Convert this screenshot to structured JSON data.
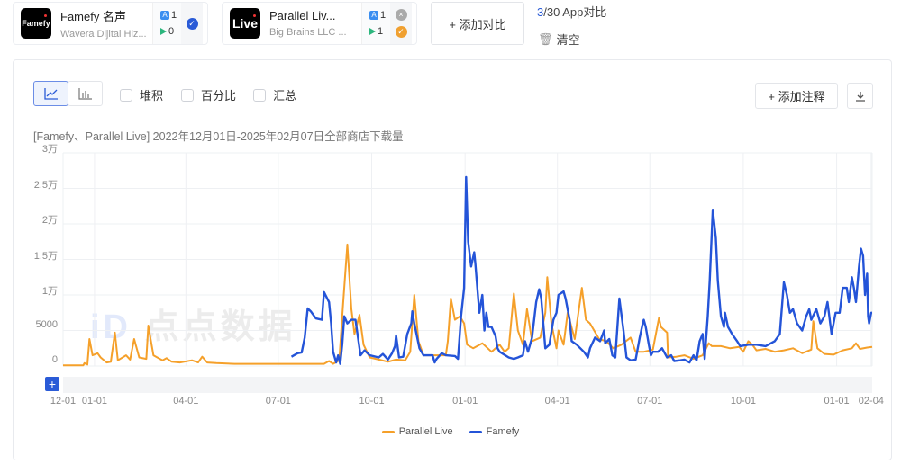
{
  "apps": [
    {
      "name": "Famefy  名声",
      "developer": "Wavera Dijital Hiz...",
      "logo_text": "Famefy",
      "ios_count": "1",
      "gp_count": "0",
      "check_color": "#2a5bd7"
    },
    {
      "name": "Parallel Liv...",
      "developer": "Big Brains LLC  ...",
      "logo_text": "Live",
      "ios_count": "1",
      "gp_count": "1",
      "check_color": "#f0a030"
    }
  ],
  "add_compare": "+ 添加对比",
  "compare_count": "3",
  "compare_total": "/30 App对比",
  "clear": "清空",
  "toolbar": {
    "stack": "堆积",
    "percent": "百分比",
    "sum": "汇总",
    "add_note": "+ 添加注释"
  },
  "watermark": "点点数据",
  "chart_data": {
    "type": "line",
    "title": "[Famefy、Parallel Live] 2022年12月01日-2025年02月07日全部商店下载量",
    "x_unit": "days since 2022-12-01",
    "xlim": [
      0,
      797
    ],
    "ylim": [
      0,
      30000
    ],
    "grid": true,
    "legend_position": "bottom",
    "y_ticks": [
      {
        "v": 0,
        "label": "0"
      },
      {
        "v": 5000,
        "label": "5000"
      },
      {
        "v": 10000,
        "label": "1万"
      },
      {
        "v": 15000,
        "label": "1.5万"
      },
      {
        "v": 20000,
        "label": "2万"
      },
      {
        "v": 25000,
        "label": "2.5万"
      },
      {
        "v": 30000,
        "label": "3万"
      }
    ],
    "x_ticks": [
      {
        "v": 0,
        "label": "12-01"
      },
      {
        "v": 31,
        "label": "01-01"
      },
      {
        "v": 121,
        "label": "04-01"
      },
      {
        "v": 212,
        "label": "07-01"
      },
      {
        "v": 304,
        "label": "10-01"
      },
      {
        "v": 396,
        "label": "01-01"
      },
      {
        "v": 487,
        "label": "04-01"
      },
      {
        "v": 578,
        "label": "07-01"
      },
      {
        "v": 670,
        "label": "10-01"
      },
      {
        "v": 762,
        "label": "01-01"
      },
      {
        "v": 796,
        "label": "02-04"
      }
    ],
    "series": [
      {
        "name": "Parallel Live",
        "color": "#f5a02a",
        "points": [
          [
            0,
            100
          ],
          [
            20,
            100
          ],
          [
            21,
            400
          ],
          [
            24,
            200
          ],
          [
            26,
            3800
          ],
          [
            29,
            1500
          ],
          [
            34,
            1800
          ],
          [
            37,
            1200
          ],
          [
            43,
            500
          ],
          [
            47,
            600
          ],
          [
            51,
            4700
          ],
          [
            54,
            800
          ],
          [
            62,
            1500
          ],
          [
            66,
            900
          ],
          [
            70,
            3800
          ],
          [
            75,
            1200
          ],
          [
            82,
            1000
          ],
          [
            84,
            5700
          ],
          [
            89,
            1500
          ],
          [
            98,
            800
          ],
          [
            102,
            1100
          ],
          [
            107,
            600
          ],
          [
            115,
            500
          ],
          [
            127,
            800
          ],
          [
            133,
            500
          ],
          [
            137,
            1300
          ],
          [
            142,
            500
          ],
          [
            151,
            400
          ],
          [
            169,
            300
          ],
          [
            257,
            300
          ],
          [
            262,
            700
          ],
          [
            266,
            300
          ],
          [
            272,
            800
          ],
          [
            276,
            9100
          ],
          [
            280,
            17100
          ],
          [
            284,
            8000
          ],
          [
            287,
            4500
          ],
          [
            292,
            7200
          ],
          [
            296,
            3000
          ],
          [
            302,
            1200
          ],
          [
            311,
            900
          ],
          [
            320,
            600
          ],
          [
            328,
            900
          ],
          [
            337,
            800
          ],
          [
            342,
            2000
          ],
          [
            346,
            10000
          ],
          [
            350,
            3500
          ],
          [
            355,
            1500
          ],
          [
            364,
            1500
          ],
          [
            377,
            1500
          ],
          [
            379,
            3500
          ],
          [
            382,
            9500
          ],
          [
            386,
            6500
          ],
          [
            391,
            7000
          ],
          [
            395,
            6000
          ],
          [
            398,
            3000
          ],
          [
            404,
            2500
          ],
          [
            413,
            3200
          ],
          [
            422,
            2000
          ],
          [
            430,
            3000
          ],
          [
            435,
            2000
          ],
          [
            439,
            2500
          ],
          [
            444,
            10200
          ],
          [
            448,
            5000
          ],
          [
            453,
            3000
          ],
          [
            457,
            8000
          ],
          [
            462,
            3500
          ],
          [
            470,
            4000
          ],
          [
            475,
            7500
          ],
          [
            477,
            12500
          ],
          [
            481,
            6000
          ],
          [
            486,
            2500
          ],
          [
            488,
            5000
          ],
          [
            493,
            3000
          ],
          [
            497,
            7500
          ],
          [
            504,
            3800
          ],
          [
            511,
            11000
          ],
          [
            515,
            6500
          ],
          [
            519,
            6000
          ],
          [
            528,
            3800
          ],
          [
            535,
            3500
          ],
          [
            542,
            2500
          ],
          [
            550,
            3000
          ],
          [
            559,
            4000
          ],
          [
            564,
            2000
          ],
          [
            572,
            2000
          ],
          [
            581,
            2300
          ],
          [
            587,
            6800
          ],
          [
            589,
            5500
          ],
          [
            595,
            4700
          ],
          [
            596,
            1200
          ],
          [
            604,
            1300
          ],
          [
            612,
            1500
          ],
          [
            621,
            1000
          ],
          [
            630,
            1500
          ],
          [
            636,
            3200
          ],
          [
            639,
            2800
          ],
          [
            648,
            2800
          ],
          [
            657,
            2500
          ],
          [
            666,
            2700
          ],
          [
            670,
            2000
          ],
          [
            675,
            3500
          ],
          [
            679,
            3000
          ],
          [
            683,
            2200
          ],
          [
            692,
            2400
          ],
          [
            701,
            2000
          ],
          [
            710,
            2200
          ],
          [
            719,
            2500
          ],
          [
            728,
            1800
          ],
          [
            737,
            2300
          ],
          [
            739,
            6300
          ],
          [
            743,
            2500
          ],
          [
            750,
            1700
          ],
          [
            759,
            1600
          ],
          [
            768,
            2200
          ],
          [
            777,
            2500
          ],
          [
            781,
            3200
          ],
          [
            785,
            2400
          ],
          [
            792,
            2600
          ],
          [
            797,
            2700
          ]
        ]
      },
      {
        "name": "Famefy",
        "color": "#2454d8",
        "points": [
          [
            225,
            1300
          ],
          [
            231,
            1800
          ],
          [
            235,
            1900
          ],
          [
            238,
            4000
          ],
          [
            241,
            8100
          ],
          [
            244,
            7700
          ],
          [
            249,
            6700
          ],
          [
            255,
            6500
          ],
          [
            257,
            10400
          ],
          [
            262,
            9000
          ],
          [
            264,
            6000
          ],
          [
            266,
            2000
          ],
          [
            269,
            500
          ],
          [
            271,
            1500
          ],
          [
            273,
            300
          ],
          [
            275,
            3000
          ],
          [
            277,
            7000
          ],
          [
            280,
            6000
          ],
          [
            284,
            6500
          ],
          [
            288,
            6500
          ],
          [
            291,
            3500
          ],
          [
            293,
            1500
          ],
          [
            297,
            2200
          ],
          [
            302,
            1500
          ],
          [
            311,
            1200
          ],
          [
            315,
            1700
          ],
          [
            320,
            900
          ],
          [
            324,
            1800
          ],
          [
            327,
            2800
          ],
          [
            328,
            4300
          ],
          [
            331,
            1200
          ],
          [
            335,
            1300
          ],
          [
            339,
            4500
          ],
          [
            343,
            6000
          ],
          [
            344,
            7700
          ],
          [
            346,
            6000
          ],
          [
            351,
            2500
          ],
          [
            355,
            1500
          ],
          [
            364,
            1500
          ],
          [
            366,
            500
          ],
          [
            368,
            1000
          ],
          [
            373,
            1800
          ],
          [
            377,
            1500
          ],
          [
            386,
            1400
          ],
          [
            389,
            1000
          ],
          [
            392,
            7000
          ],
          [
            395,
            11000
          ],
          [
            397,
            26600
          ],
          [
            399,
            17500
          ],
          [
            402,
            14000
          ],
          [
            405,
            16000
          ],
          [
            406,
            14500
          ],
          [
            410,
            7500
          ],
          [
            413,
            10000
          ],
          [
            415,
            5000
          ],
          [
            417,
            7500
          ],
          [
            419,
            5500
          ],
          [
            422,
            5500
          ],
          [
            426,
            4200
          ],
          [
            428,
            2500
          ],
          [
            430,
            2000
          ],
          [
            439,
            1200
          ],
          [
            444,
            1000
          ],
          [
            448,
            1200
          ],
          [
            453,
            1500
          ],
          [
            455,
            3500
          ],
          [
            458,
            2000
          ],
          [
            462,
            4000
          ],
          [
            466,
            9000
          ],
          [
            469,
            10800
          ],
          [
            471,
            9500
          ],
          [
            475,
            2500
          ],
          [
            479,
            3000
          ],
          [
            483,
            6500
          ],
          [
            486,
            7500
          ],
          [
            488,
            10000
          ],
          [
            493,
            10500
          ],
          [
            495,
            9500
          ],
          [
            499,
            6500
          ],
          [
            501,
            3500
          ],
          [
            506,
            3000
          ],
          [
            513,
            2000
          ],
          [
            517,
            1200
          ],
          [
            519,
            2500
          ],
          [
            524,
            4000
          ],
          [
            529,
            3500
          ],
          [
            533,
            5000
          ],
          [
            534,
            3200
          ],
          [
            538,
            3800
          ],
          [
            541,
            1500
          ],
          [
            544,
            1200
          ],
          [
            548,
            9500
          ],
          [
            552,
            5000
          ],
          [
            555,
            1200
          ],
          [
            559,
            800
          ],
          [
            564,
            900
          ],
          [
            568,
            4000
          ],
          [
            571,
            6000
          ],
          [
            572,
            6500
          ],
          [
            574,
            5500
          ],
          [
            577,
            3000
          ],
          [
            579,
            1500
          ],
          [
            581,
            2000
          ],
          [
            586,
            2000
          ],
          [
            590,
            2500
          ],
          [
            595,
            1200
          ],
          [
            599,
            1500
          ],
          [
            602,
            700
          ],
          [
            608,
            800
          ],
          [
            612,
            900
          ],
          [
            617,
            500
          ],
          [
            621,
            1500
          ],
          [
            624,
            800
          ],
          [
            627,
            3500
          ],
          [
            630,
            4500
          ],
          [
            632,
            1000
          ],
          [
            635,
            7000
          ],
          [
            637,
            12000
          ],
          [
            640,
            22000
          ],
          [
            643,
            18000
          ],
          [
            645,
            12000
          ],
          [
            648,
            7000
          ],
          [
            651,
            5500
          ],
          [
            652,
            7500
          ],
          [
            655,
            5500
          ],
          [
            659,
            4500
          ],
          [
            664,
            3500
          ],
          [
            667,
            2800
          ],
          [
            675,
            3000
          ],
          [
            683,
            3000
          ],
          [
            692,
            2800
          ],
          [
            701,
            3500
          ],
          [
            706,
            4500
          ],
          [
            710,
            11800
          ],
          [
            713,
            10000
          ],
          [
            716,
            7500
          ],
          [
            719,
            8000
          ],
          [
            723,
            6000
          ],
          [
            728,
            5000
          ],
          [
            732,
            7000
          ],
          [
            735,
            8000
          ],
          [
            737,
            6500
          ],
          [
            742,
            8000
          ],
          [
            746,
            6000
          ],
          [
            750,
            7000
          ],
          [
            753,
            9000
          ],
          [
            757,
            4500
          ],
          [
            761,
            7500
          ],
          [
            765,
            7500
          ],
          [
            768,
            11000
          ],
          [
            772,
            11000
          ],
          [
            774,
            9000
          ],
          [
            777,
            12500
          ],
          [
            779,
            11000
          ],
          [
            781,
            9000
          ],
          [
            784,
            14000
          ],
          [
            786,
            16500
          ],
          [
            788,
            15500
          ],
          [
            790,
            10000
          ],
          [
            792,
            13000
          ],
          [
            793,
            7000
          ],
          [
            794,
            6000
          ],
          [
            796,
            7500
          ],
          [
            797,
            7500
          ]
        ]
      }
    ]
  }
}
